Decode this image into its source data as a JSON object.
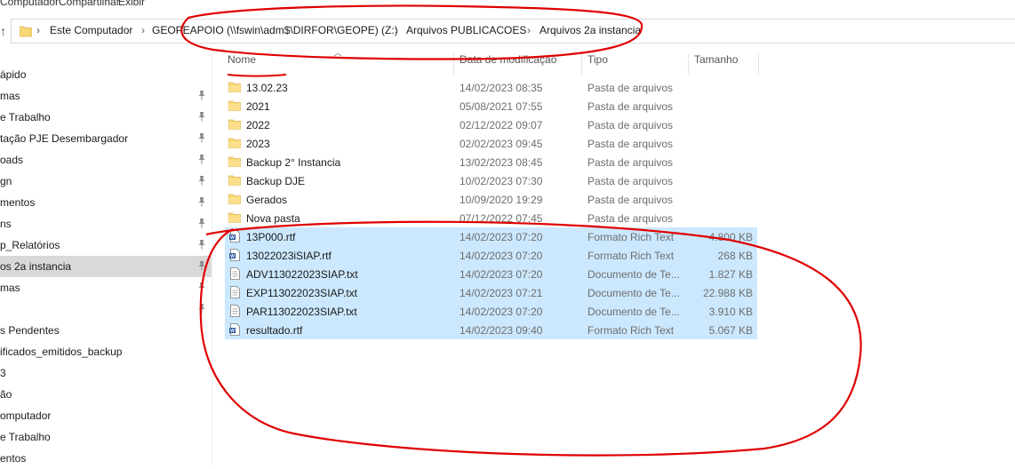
{
  "ribbon": {
    "tabs": [
      "Computador",
      "Compartilhar",
      "Exibir"
    ]
  },
  "address": {
    "crumbs": [
      "Este Computador",
      "GEOPEAPOIO (\\\\fswin\\adm$\\DIRFOR\\GEOPE) (Z:)",
      "Arquivos PUBLICACOES",
      "Arquivos 2a instancia"
    ]
  },
  "columns": {
    "name": "Nome",
    "date": "Data de modificação",
    "type": "Tipo",
    "size": "Tamanho"
  },
  "nav": {
    "items": [
      {
        "label": "ápido",
        "pinned": false
      },
      {
        "label": "mas",
        "pinned": true
      },
      {
        "label": "e Trabalho",
        "pinned": true
      },
      {
        "label": "tação PJE Desembargador",
        "pinned": true
      },
      {
        "label": "oads",
        "pinned": true
      },
      {
        "label": "gn",
        "pinned": true
      },
      {
        "label": "mentos",
        "pinned": true
      },
      {
        "label": "ns",
        "pinned": true
      },
      {
        "label": "p_Relatórios",
        "pinned": true
      },
      {
        "label": "os 2a instancia",
        "pinned": true,
        "selected": true
      },
      {
        "label": "mas",
        "pinned": true
      },
      {
        "label": "",
        "pinned": true
      },
      {
        "label": "s Pendentes",
        "pinned": false
      },
      {
        "label": "ificados_emitidos_backup",
        "pinned": false
      },
      {
        "label": "3",
        "pinned": false
      },
      {
        "label": "ão",
        "pinned": false
      },
      {
        "label": "omputador",
        "pinned": false
      },
      {
        "label": "e Trabalho",
        "pinned": false
      },
      {
        "label": "entos",
        "pinned": false
      }
    ]
  },
  "files": [
    {
      "name": "13.02.23",
      "date": "14/02/2023 08:35",
      "type": "Pasta de arquivos",
      "size": "",
      "icon": "folder-icon",
      "selected": false
    },
    {
      "name": "2021",
      "date": "05/08/2021 07:55",
      "type": "Pasta de arquivos",
      "size": "",
      "icon": "folder-icon",
      "selected": false
    },
    {
      "name": "2022",
      "date": "02/12/2022 09:07",
      "type": "Pasta de arquivos",
      "size": "",
      "icon": "folder-icon",
      "selected": false
    },
    {
      "name": "2023",
      "date": "02/02/2023 09:45",
      "type": "Pasta de arquivos",
      "size": "",
      "icon": "folder-icon",
      "selected": false
    },
    {
      "name": "Backup 2° Instancia",
      "date": "13/02/2023 08:45",
      "type": "Pasta de arquivos",
      "size": "",
      "icon": "folder-icon",
      "selected": false
    },
    {
      "name": "Backup DJE",
      "date": "10/02/2023 07:30",
      "type": "Pasta de arquivos",
      "size": "",
      "icon": "folder-icon",
      "selected": false
    },
    {
      "name": "Gerados",
      "date": "10/09/2020 19:29",
      "type": "Pasta de arquivos",
      "size": "",
      "icon": "folder-icon",
      "selected": false
    },
    {
      "name": "Nova pasta",
      "date": "07/12/2022 07:45",
      "type": "Pasta de arquivos",
      "size": "",
      "icon": "folder-icon",
      "selected": false
    },
    {
      "name": "13P000.rtf",
      "date": "14/02/2023 07:20",
      "type": "Formato Rich Text",
      "size": "4.800 KB",
      "icon": "word-doc-icon",
      "selected": true
    },
    {
      "name": "13022023iSIAP.rtf",
      "date": "14/02/2023 07:20",
      "type": "Formato Rich Text",
      "size": "268 KB",
      "icon": "word-doc-icon",
      "selected": true
    },
    {
      "name": "ADV113022023SIAP.txt",
      "date": "14/02/2023 07:20",
      "type": "Documento de Te...",
      "size": "1.827 KB",
      "icon": "text-file-icon",
      "selected": true
    },
    {
      "name": "EXP113022023SIAP.txt",
      "date": "14/02/2023 07:21",
      "type": "Documento de Te...",
      "size": "22.988 KB",
      "icon": "text-file-icon",
      "selected": true
    },
    {
      "name": "PAR113022023SIAP.txt",
      "date": "14/02/2023 07:20",
      "type": "Documento de Te...",
      "size": "3.910 KB",
      "icon": "text-file-icon",
      "selected": true
    },
    {
      "name": "resultado.rtf",
      "date": "14/02/2023 09:40",
      "type": "Formato Rich Text",
      "size": "5.067 KB",
      "icon": "word-doc-icon",
      "selected": true
    }
  ],
  "colors": {
    "selection": "#cce8ff",
    "nav_selected": "#d9d9d9",
    "folder": "#f8d775",
    "annotation": "#e00000"
  }
}
